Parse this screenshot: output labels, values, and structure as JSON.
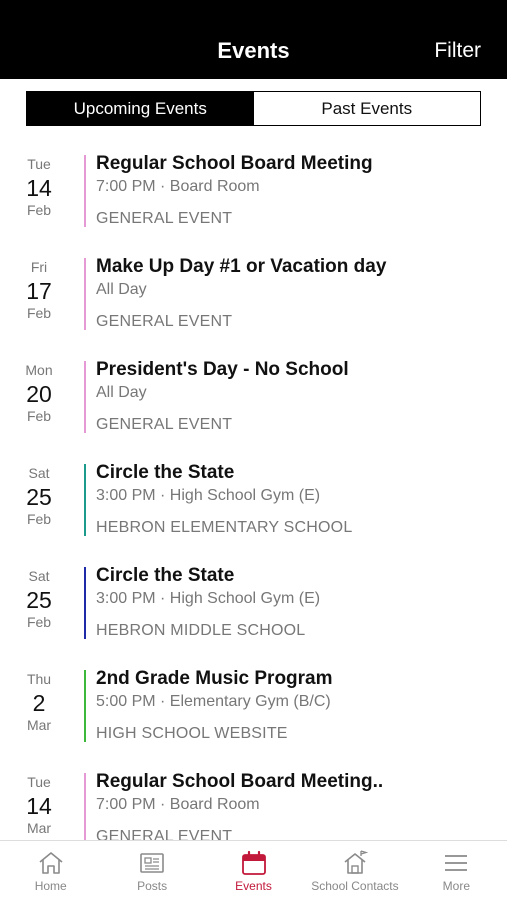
{
  "header": {
    "title": "Events",
    "filter_label": "Filter"
  },
  "segments": {
    "upcoming": "Upcoming Events",
    "past": "Past Events"
  },
  "events": [
    {
      "dow": "Tue",
      "day": "14",
      "month": "Feb",
      "title": "Regular School Board Meeting",
      "time": "7:00 PM · Board Room",
      "category": "GENERAL EVENT",
      "color": "#e59ad6"
    },
    {
      "dow": "Fri",
      "day": "17",
      "month": "Feb",
      "title": "Make Up Day #1 or Vacation day",
      "time": "All Day",
      "category": "GENERAL EVENT",
      "color": "#e59ad6"
    },
    {
      "dow": "Mon",
      "day": "20",
      "month": "Feb",
      "title": "President's Day - No School",
      "time": "All Day",
      "category": "GENERAL EVENT",
      "color": "#e59ad6"
    },
    {
      "dow": "Sat",
      "day": "25",
      "month": "Feb",
      "title": "Circle the State",
      "time": "3:00 PM · High School Gym (E)",
      "category": "HEBRON ELEMENTARY SCHOOL",
      "color": "#1a9b8c"
    },
    {
      "dow": "Sat",
      "day": "25",
      "month": "Feb",
      "title": "Circle the State",
      "time": "3:00 PM · High School Gym (E)",
      "category": "HEBRON MIDDLE SCHOOL",
      "color": "#1f2aa8"
    },
    {
      "dow": "Thu",
      "day": "2",
      "month": "Mar",
      "title": "2nd Grade Music Program",
      "time": "5:00 PM · Elementary Gym (B/C)",
      "category": "HIGH SCHOOL WEBSITE",
      "color": "#3cb83a"
    },
    {
      "dow": "Tue",
      "day": "14",
      "month": "Mar",
      "title": "Regular School Board Meeting..",
      "time": "7:00 PM · Board Room",
      "category": "GENERAL EVENT",
      "color": "#e59ad6"
    }
  ],
  "tabbar": {
    "home": "Home",
    "posts": "Posts",
    "events": "Events",
    "contacts": "School Contacts",
    "more": "More"
  },
  "colors": {
    "accent": "#c2183a",
    "header_bg": "#000000"
  }
}
